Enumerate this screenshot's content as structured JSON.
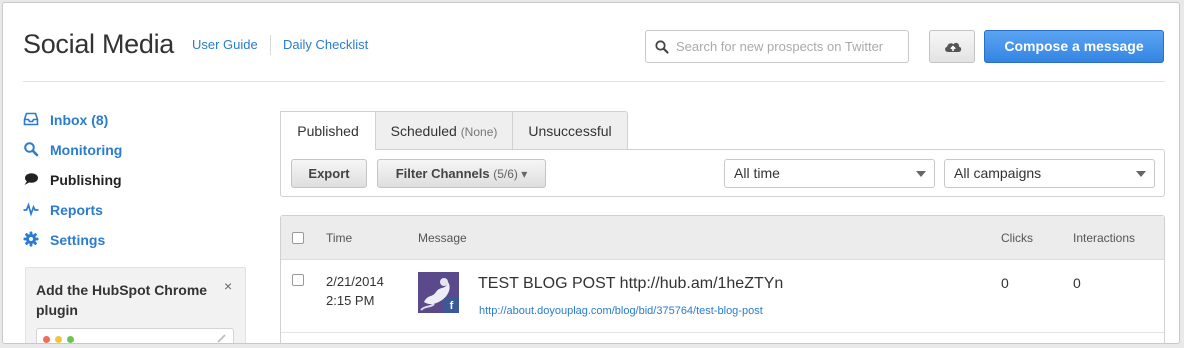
{
  "header": {
    "title": "Social Media",
    "links": [
      "User Guide",
      "Daily Checklist"
    ],
    "search_placeholder": "Search for new prospects on Twitter",
    "compose_label": "Compose a message"
  },
  "sidebar": {
    "items": [
      {
        "label": "Inbox (8)",
        "icon": "inbox-icon"
      },
      {
        "label": "Monitoring",
        "icon": "search-icon"
      },
      {
        "label": "Publishing",
        "icon": "speech-bubble-icon"
      },
      {
        "label": "Reports",
        "icon": "pulse-icon"
      },
      {
        "label": "Settings",
        "icon": "gear-icon"
      }
    ],
    "plugin": {
      "title": "Add the HubSpot Chrome plugin",
      "close": "×"
    }
  },
  "tabs": [
    {
      "label": "Published",
      "count": ""
    },
    {
      "label": "Scheduled",
      "count": "(None)"
    },
    {
      "label": "Unsuccessful",
      "count": ""
    }
  ],
  "toolbar": {
    "export_label": "Export",
    "filter_label": "Filter Channels",
    "filter_count": "(5/6) ▾",
    "time_select": "All time",
    "campaign_select": "All campaigns"
  },
  "table": {
    "columns": [
      "Time",
      "Message",
      "Clicks",
      "Interactions"
    ],
    "rows": [
      {
        "date": "2/21/2014",
        "time": "2:15 PM",
        "message": "TEST BLOG POST http://hub.am/1heZTYn",
        "link": "http://about.doyouplag.com/blog/bid/375764/test-blog-post",
        "clicks": "0",
        "interactions": "0"
      }
    ]
  },
  "colors": {
    "link": "#2a7ccf",
    "primary_button": "#3a8ae6",
    "facebook": "#3b5998"
  }
}
